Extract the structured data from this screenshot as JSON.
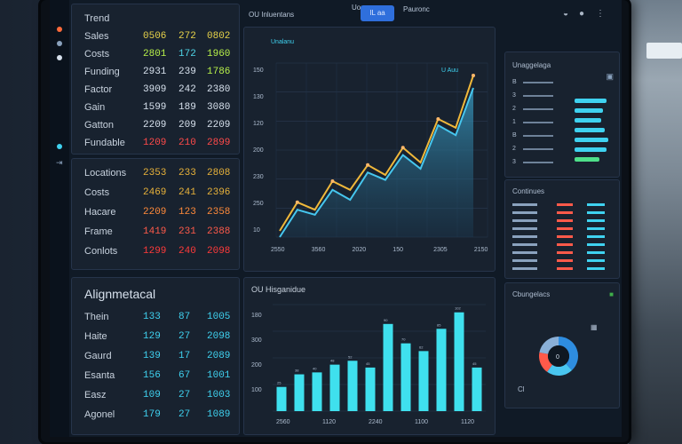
{
  "top_table": {
    "title": "Trend",
    "rows": [
      {
        "label": "Sales",
        "values": [
          "0506",
          "272",
          "0802"
        ],
        "colors": [
          "#e8d34a",
          "#e8d34a",
          "#e8d34a"
        ]
      },
      {
        "label": "Costs",
        "values": [
          "2801",
          "172",
          "1960"
        ],
        "colors": [
          "#b7f04a",
          "#4fd6e8",
          "#b7f04a"
        ]
      },
      {
        "label": "Funding",
        "values": [
          "2931",
          "239",
          "1786"
        ],
        "colors": [
          "#d6e0ec",
          "#d6e0ec",
          "#b7f04a"
        ]
      },
      {
        "label": "Factor",
        "values": [
          "3909",
          "242",
          "2380"
        ],
        "colors": [
          "#d6e0ec",
          "#d6e0ec",
          "#d6e0ec"
        ]
      },
      {
        "label": "Gain",
        "values": [
          "1599",
          "189",
          "3080"
        ],
        "colors": [
          "#d6e0ec",
          "#d6e0ec",
          "#d6e0ec"
        ]
      },
      {
        "label": "Gatton",
        "values": [
          "2209",
          "209",
          "2209"
        ],
        "colors": [
          "#d6e0ec",
          "#d6e0ec",
          "#d6e0ec"
        ]
      },
      {
        "label": "Fundable",
        "values": [
          "1209",
          "210",
          "2899"
        ],
        "colors": [
          "#ff4a4a",
          "#ff4a4a",
          "#ff4a4a"
        ]
      }
    ]
  },
  "middle_table": {
    "rows": [
      {
        "label": "Locations",
        "values": [
          "2353",
          "233",
          "2808"
        ],
        "colors": [
          "#e8b23a",
          "#e8b23a",
          "#e8b23a"
        ]
      },
      {
        "label": "Costs",
        "values": [
          "2469",
          "241",
          "2396"
        ],
        "colors": [
          "#e8b23a",
          "#e8b23a",
          "#e8b23a"
        ]
      },
      {
        "label": "Hacare",
        "values": [
          "2209",
          "123",
          "2358"
        ],
        "colors": [
          "#ff8a3a",
          "#ff8a3a",
          "#ff8a3a"
        ]
      },
      {
        "label": "Frame",
        "values": [
          "1419",
          "231",
          "2388"
        ],
        "colors": [
          "#ff5a4a",
          "#ff5a4a",
          "#ff5a4a"
        ]
      },
      {
        "label": "Conlots",
        "values": [
          "1299",
          "240",
          "2098"
        ],
        "colors": [
          "#ff3a3a",
          "#ff3a3a",
          "#ff3a3a"
        ]
      }
    ]
  },
  "bottom_table": {
    "title": "Alignmetacal",
    "rows": [
      {
        "label": "Thein",
        "values": [
          "133",
          "87",
          "1005"
        ]
      },
      {
        "label": "Haite",
        "values": [
          "129",
          "27",
          "2098"
        ]
      },
      {
        "label": "Gaurd",
        "values": [
          "139",
          "17",
          "2089"
        ]
      },
      {
        "label": "Esanta",
        "values": [
          "156",
          "67",
          "1001"
        ]
      },
      {
        "label": "Easz",
        "values": [
          "109",
          "27",
          "1003"
        ]
      },
      {
        "label": "Agonel",
        "values": [
          "179",
          "27",
          "1089"
        ]
      }
    ],
    "color": "#3fd2f0"
  },
  "topbar": {
    "title": "OU Inluentans",
    "items": [
      "Uoroma",
      "Pauronc"
    ],
    "active_tab": "IL aa"
  },
  "line_chart_panel": {
    "subtitle": "Unalanu",
    "legend": "U Auu"
  },
  "bar_chart_panel": {
    "title": "OU Hisganidue"
  },
  "right_top_panel": {
    "title": "Unaggelaga",
    "items": [
      "B",
      "3",
      "2",
      "1",
      "B",
      "2",
      "3"
    ]
  },
  "right_mid_panel": {
    "title": "Continues"
  },
  "donut_panel": {
    "title": "Cbungelacs",
    "center": "0",
    "caption": "Cl"
  },
  "chart_data": [
    {
      "type": "line",
      "categories": [
        "2550",
        "3560",
        "2020",
        "150",
        "2305",
        "2150"
      ],
      "y_ticks": [
        "150",
        "130",
        "120",
        "200",
        "230",
        "250",
        "10"
      ],
      "series": [
        {
          "values": [
            5,
            28,
            22,
            45,
            38,
            58,
            50,
            72,
            60,
            95,
            88,
            130
          ],
          "color": "#f0b83a"
        },
        {
          "values": [
            0,
            22,
            18,
            38,
            30,
            52,
            46,
            66,
            55,
            90,
            82,
            120
          ],
          "color": "#46c6ee"
        }
      ],
      "ylim": [
        0,
        140
      ]
    },
    {
      "type": "bar",
      "categories": [
        "2560",
        "1120",
        "2240",
        "1100",
        "1120"
      ],
      "y_ticks": [
        "180",
        "300",
        "200",
        "100"
      ],
      "values": [
        25,
        38,
        40,
        48,
        52,
        45,
        90,
        70,
        62,
        85,
        102,
        45
      ],
      "ylim": [
        0,
        110
      ],
      "color": "#3fe0ee"
    },
    {
      "type": "pie",
      "values": [
        38,
        22,
        18,
        22
      ],
      "colors": [
        "#2e8de0",
        "#49c6f0",
        "#ff5a4a",
        "#8ab0d8"
      ]
    }
  ]
}
